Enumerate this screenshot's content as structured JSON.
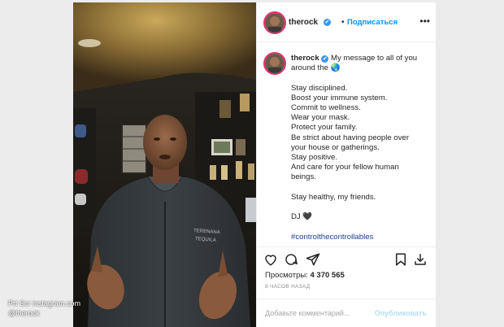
{
  "header": {
    "username": "therock",
    "verified_mark": "✔",
    "dot": "•",
    "follow_label": "Подписаться",
    "more_label": "•••"
  },
  "caption": {
    "username": "therock",
    "lines": [
      "My message to all of you",
      "around the 🌏",
      "",
      "Stay disciplined.",
      "Boost your immune system.",
      "Commit to wellness.",
      "Wear your mask.",
      "Protect your family.",
      "Be strict about having people over",
      "your house or gatherings.",
      "Stay positive.",
      "And care for your fellow human",
      "beings.",
      "",
      "Stay healthy, my friends.",
      "",
      "DJ 🖤",
      "",
      "#controlthecontrollables"
    ]
  },
  "stats": {
    "views_label": "Просмотры:",
    "views_value": "4 370 565",
    "time_ago": "8 ЧАСОВ НАЗАД"
  },
  "comment": {
    "placeholder": "Добавьте комментарий...",
    "publish_label": "Опубликовать"
  },
  "watermark": {
    "line1": "Prt Scr instagram.com",
    "line2": "@therock"
  },
  "icons": [
    "heart-icon",
    "comment-icon",
    "share-icon",
    "bookmark-icon",
    "download-icon",
    "more-icon",
    "verified-badge-icon"
  ],
  "colors": {
    "accent": "#0095f6",
    "verified": "#3897f0",
    "avatar_ring": "#e1306c"
  }
}
